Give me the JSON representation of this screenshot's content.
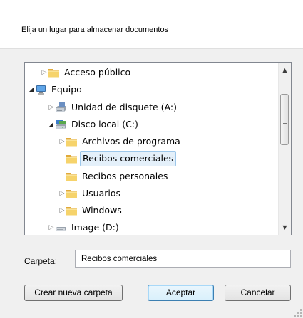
{
  "header": {
    "instruction": "Elija un lugar para almacenar documentos"
  },
  "tree": {
    "items": [
      {
        "label": "Acceso público",
        "icon": "folder-icon",
        "arrow": "collapsed",
        "level": 1,
        "selected": false
      },
      {
        "label": "Equipo",
        "icon": "computer-icon",
        "arrow": "expanded",
        "level": 0,
        "selected": false
      },
      {
        "label": "Unidad de disquete (A:)",
        "icon": "floppy-drive-icon",
        "arrow": "collapsed",
        "level": 1,
        "selected": false
      },
      {
        "label": "Disco local (C:)",
        "icon": "local-disk-icon",
        "arrow": "expanded",
        "level": 1,
        "selected": false
      },
      {
        "label": "Archivos de programa",
        "icon": "folder-icon",
        "arrow": "collapsed",
        "level": 2,
        "selected": false
      },
      {
        "label": "Recibos comerciales",
        "icon": "folder-icon",
        "arrow": "none",
        "level": 2,
        "selected": true
      },
      {
        "label": "Recibos personales",
        "icon": "folder-icon",
        "arrow": "none",
        "level": 2,
        "selected": false
      },
      {
        "label": "Usuarios",
        "icon": "folder-icon",
        "arrow": "collapsed",
        "level": 2,
        "selected": false
      },
      {
        "label": "Windows",
        "icon": "folder-icon",
        "arrow": "collapsed",
        "level": 2,
        "selected": false
      },
      {
        "label": "Image (D:)",
        "icon": "drive-icon",
        "arrow": "collapsed",
        "level": 1,
        "selected": false
      }
    ]
  },
  "folder": {
    "label": "Carpeta:",
    "value": "Recibos comerciales"
  },
  "buttons": {
    "new_folder": "Crear nueva carpeta",
    "ok": "Aceptar",
    "cancel": "Cancelar"
  },
  "colors": {
    "selection_bg": "#e4f0fa",
    "selection_border": "#9dc7ea",
    "folder_yellow": "#f3c84a"
  }
}
